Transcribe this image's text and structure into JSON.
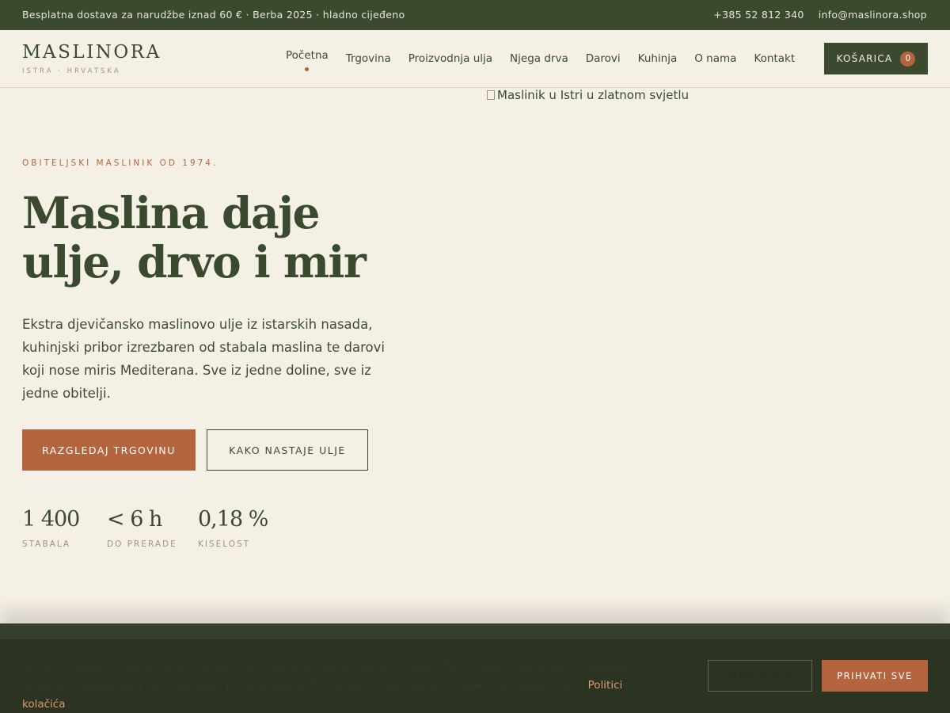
{
  "topbar": {
    "announcement": "Besplatna dostava za narudžbe iznad 60 €  ·  Berba 2025 · hladno cijeđeno",
    "phone": "+385 52 812 340",
    "email": "info@maslinora.shop"
  },
  "header": {
    "logo": "MASLINORA",
    "logo_sub": "ISTRA · HRVATSKA",
    "nav": [
      {
        "label": "Početna",
        "active": true
      },
      {
        "label": "Trgovina"
      },
      {
        "label": "Proizvodnja ulja"
      },
      {
        "label": "Njega drva"
      },
      {
        "label": "Darovi"
      },
      {
        "label": "Kuhinja"
      },
      {
        "label": "O nama"
      },
      {
        "label": "Kontakt"
      }
    ],
    "cart_label": "KOŠARICA",
    "cart_count": "0"
  },
  "hero": {
    "eyebrow": "OBITELJSKI MASLINIK OD 1974.",
    "headline": "Maslina daje ulje, drvo i mir",
    "lead": "Ekstra djevičansko maslinovo ulje iz istarskih nasada, kuhinjski pribor izrezbaren od stabala maslina te darovi koji nose miris Mediterana. Sve iz jedne doline, sve iz jedne obitelji.",
    "primary_button": "RAZGLEDAJ TRGOVINU",
    "secondary_button": "KAKO NASTAJE ULJE",
    "image_alt": "Maslinik u Istri u zlatnom svjetlu",
    "stats": [
      {
        "value": "1 400",
        "label": "STABALA"
      },
      {
        "value": "< 6 h",
        "label": "DO PRERADE"
      },
      {
        "value": "0,18 %",
        "label": "KISELOST"
      }
    ]
  },
  "cookie": {
    "text": "Koristimo kolačiće nužne za rad trgovine te — samo uz vaš pristanak — analitičke i marketinške kolačiće (Google Analytics, Google Ads) radi mjerenja i prikaza oglasa. Pristanak možete povući u svakom trenutku. Više u",
    "link": "Politici kolačića",
    "necessary_button": "SAMO NUŽNI",
    "accept_button": "PRIHVATI SVE"
  },
  "colors": {
    "olive": "#3b4a2e",
    "terracotta": "#b5653e",
    "cream": "#f5f0e6"
  }
}
